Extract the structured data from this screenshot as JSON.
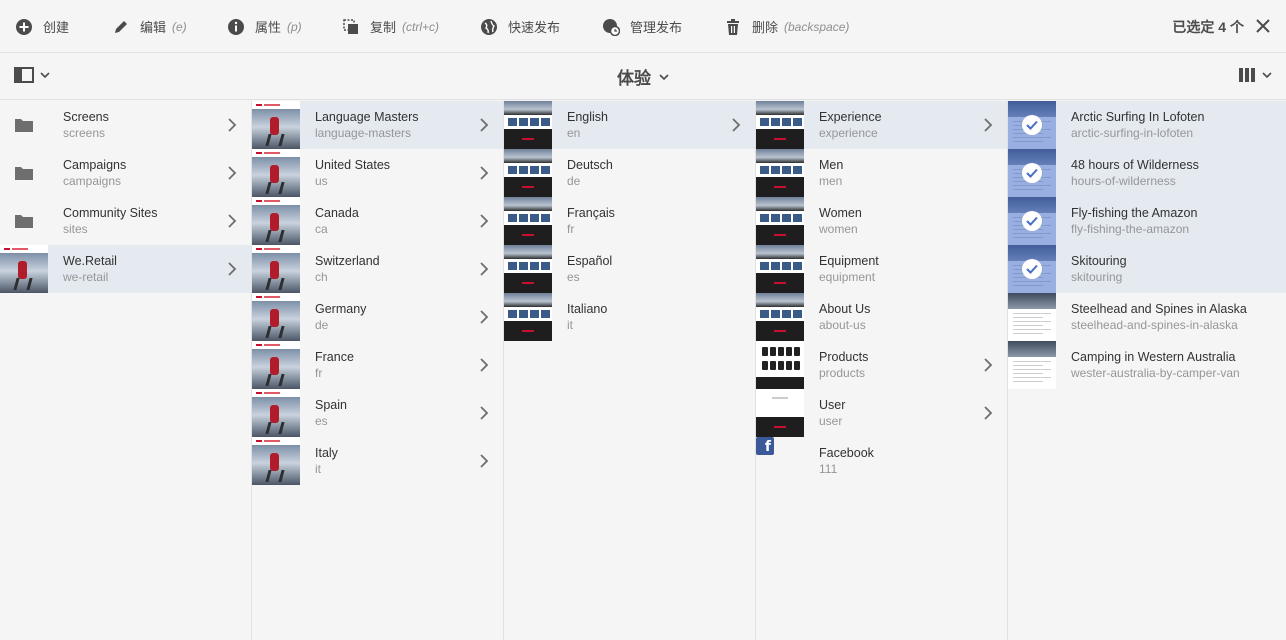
{
  "toolbar": {
    "actions": [
      {
        "label": "创建",
        "hint": ""
      },
      {
        "label": "编辑",
        "hint": "(e)"
      },
      {
        "label": "属性",
        "hint": "(p)"
      },
      {
        "label": "复制",
        "hint": "(ctrl+c)"
      },
      {
        "label": "快速发布",
        "hint": ""
      },
      {
        "label": "管理发布",
        "hint": ""
      },
      {
        "label": "删除",
        "hint": "(backspace)"
      }
    ],
    "selection_count": "已选定 4 个"
  },
  "header": {
    "title": "体验"
  },
  "columns": [
    {
      "items": [
        {
          "title": "Screens",
          "subtitle": "screens",
          "thumb": "folder",
          "chevron": true,
          "state": ""
        },
        {
          "title": "Campaigns",
          "subtitle": "campaigns",
          "thumb": "folder",
          "chevron": true,
          "state": ""
        },
        {
          "title": "Community Sites",
          "subtitle": "sites",
          "thumb": "folder",
          "chevron": true,
          "state": ""
        },
        {
          "title": "We.Retail",
          "subtitle": "we-retail",
          "thumb": "site",
          "chevron": true,
          "state": "active"
        }
      ]
    },
    {
      "items": [
        {
          "title": "Language Masters",
          "subtitle": "language-masters",
          "thumb": "site",
          "chevron": true,
          "state": "active"
        },
        {
          "title": "United States",
          "subtitle": "us",
          "thumb": "site",
          "chevron": true,
          "state": ""
        },
        {
          "title": "Canada",
          "subtitle": "ca",
          "thumb": "site",
          "chevron": true,
          "state": ""
        },
        {
          "title": "Switzerland",
          "subtitle": "ch",
          "thumb": "site",
          "chevron": true,
          "state": ""
        },
        {
          "title": "Germany",
          "subtitle": "de",
          "thumb": "site",
          "chevron": true,
          "state": ""
        },
        {
          "title": "France",
          "subtitle": "fr",
          "thumb": "site",
          "chevron": true,
          "state": ""
        },
        {
          "title": "Spain",
          "subtitle": "es",
          "thumb": "site",
          "chevron": true,
          "state": ""
        },
        {
          "title": "Italy",
          "subtitle": "it",
          "thumb": "site",
          "chevron": true,
          "state": ""
        }
      ]
    },
    {
      "items": [
        {
          "title": "English",
          "subtitle": "en",
          "thumb": "page",
          "chevron": true,
          "state": "active"
        },
        {
          "title": "Deutsch",
          "subtitle": "de",
          "thumb": "page",
          "chevron": false,
          "state": ""
        },
        {
          "title": "Français",
          "subtitle": "fr",
          "thumb": "page",
          "chevron": false,
          "state": ""
        },
        {
          "title": "Español",
          "subtitle": "es",
          "thumb": "page",
          "chevron": false,
          "state": ""
        },
        {
          "title": "Italiano",
          "subtitle": "it",
          "thumb": "page",
          "chevron": false,
          "state": ""
        }
      ]
    },
    {
      "items": [
        {
          "title": "Experience",
          "subtitle": "experience",
          "thumb": "page",
          "chevron": true,
          "state": "active"
        },
        {
          "title": "Men",
          "subtitle": "men",
          "thumb": "page",
          "chevron": false,
          "state": ""
        },
        {
          "title": "Women",
          "subtitle": "women",
          "thumb": "page",
          "chevron": false,
          "state": ""
        },
        {
          "title": "Equipment",
          "subtitle": "equipment",
          "thumb": "page",
          "chevron": false,
          "state": ""
        },
        {
          "title": "About Us",
          "subtitle": "about-us",
          "thumb": "page",
          "chevron": false,
          "state": ""
        },
        {
          "title": "Products",
          "subtitle": "products",
          "thumb": "products",
          "chevron": true,
          "state": ""
        },
        {
          "title": "User",
          "subtitle": "user",
          "thumb": "user",
          "chevron": true,
          "state": ""
        },
        {
          "title": "Facebook",
          "subtitle": "111",
          "thumb": "facebook",
          "chevron": false,
          "state": ""
        }
      ]
    },
    {
      "items": [
        {
          "title": "Arctic Surfing In Lofoten",
          "subtitle": "arctic-surfing-in-lofoten",
          "thumb": "article",
          "chevron": false,
          "state": "selected"
        },
        {
          "title": "48 hours of Wilderness",
          "subtitle": "hours-of-wilderness",
          "thumb": "article",
          "chevron": false,
          "state": "selected"
        },
        {
          "title": "Fly-fishing the Amazon",
          "subtitle": "fly-fishing-the-amazon",
          "thumb": "article",
          "chevron": false,
          "state": "selected"
        },
        {
          "title": "Skitouring",
          "subtitle": "skitouring",
          "thumb": "article",
          "chevron": false,
          "state": "selected"
        },
        {
          "title": "Steelhead and Spines in Alaska",
          "subtitle": "steelhead-and-spines-in-alaska",
          "thumb": "article",
          "chevron": false,
          "state": ""
        },
        {
          "title": "Camping in Western Australia",
          "subtitle": "wester-australia-by-camper-van",
          "thumb": "article",
          "chevron": false,
          "state": ""
        }
      ]
    }
  ],
  "colors": {
    "active_row": "#e5e9f0",
    "selected_overlay": "#466ec8",
    "text": "#323232",
    "subtext": "#969696"
  }
}
